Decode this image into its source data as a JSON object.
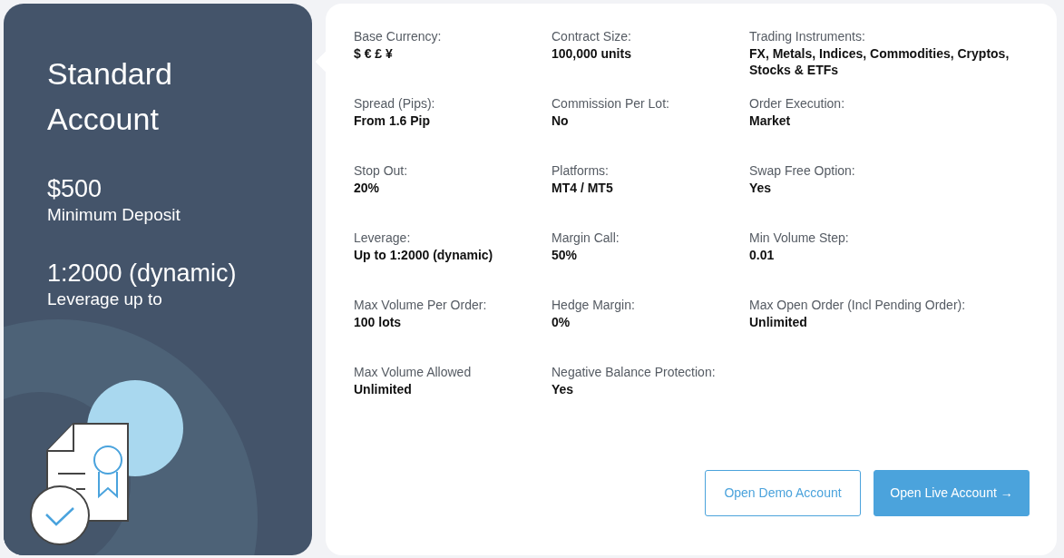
{
  "account": {
    "title_lines": [
      "Standard",
      "Account"
    ],
    "highlights": [
      {
        "value": "$500",
        "caption": "Minimum Deposit"
      },
      {
        "value": "1:2000 (dynamic)",
        "caption": "Leverage up to"
      }
    ]
  },
  "specs": [
    {
      "label": "Base Currency:",
      "value": "$ € £ ¥"
    },
    {
      "label": "Contract Size:",
      "value": "100,000 units"
    },
    {
      "label": "Trading Instruments:",
      "value": "FX, Metals, Indices, Commodities, Cryptos, Stocks & ETFs"
    },
    {
      "label": "Spread (Pips):",
      "value": "From 1.6 Pip"
    },
    {
      "label": "Commission Per Lot:",
      "value": "No"
    },
    {
      "label": "Order Execution:",
      "value": "Market"
    },
    {
      "label": "Stop Out:",
      "value": "20%"
    },
    {
      "label": "Platforms:",
      "value": "MT4 / MT5"
    },
    {
      "label": "Swap Free Option:",
      "value": "Yes"
    },
    {
      "label": "Leverage:",
      "value": "Up to 1:2000 (dynamic)"
    },
    {
      "label": "Margin Call:",
      "value": "50%"
    },
    {
      "label": "Min Volume Step:",
      "value": "0.01"
    },
    {
      "label": "Max Volume Per Order:",
      "value": "100 lots"
    },
    {
      "label": "Hedge Margin:",
      "value": "0%"
    },
    {
      "label": "Max Open Order (Incl Pending Order):",
      "value": "Unlimited"
    },
    {
      "label": "Max Volume Allowed",
      "value": "Unlimited"
    },
    {
      "label": "Negative Balance Protection:",
      "value": "Yes"
    }
  ],
  "buttons": [
    {
      "kind": "outline",
      "label": "Open Demo Account"
    },
    {
      "kind": "filled",
      "label": "Open Live Account →"
    }
  ]
}
